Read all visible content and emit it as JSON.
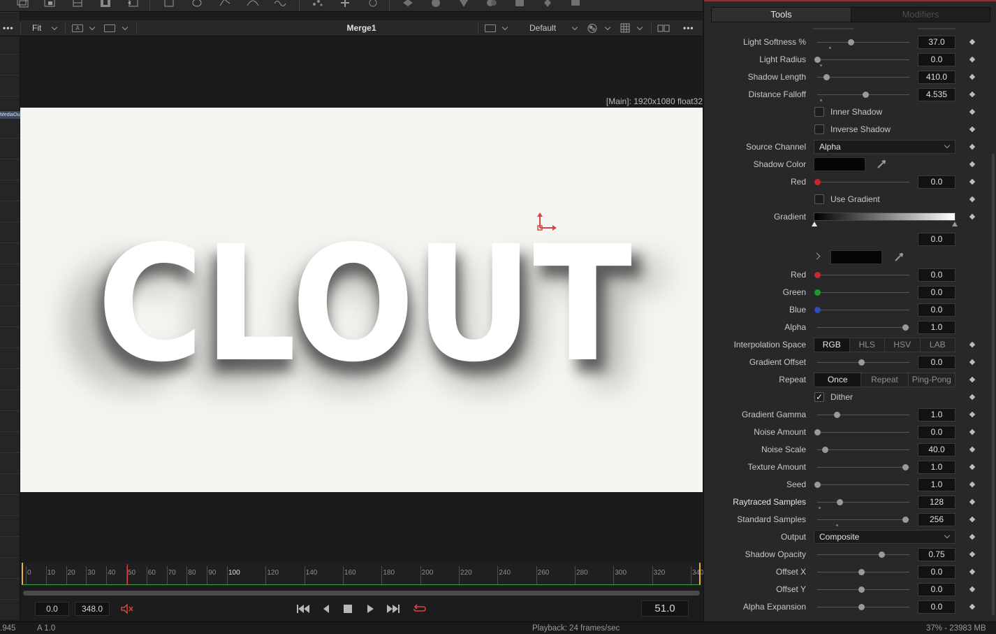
{
  "viewer": {
    "fit_label": "Fit",
    "title": "Merge1",
    "lut_label": "Default",
    "resolution_label": "[Main]: 1920x1080 float32",
    "canvas_text": "CLOUT",
    "media_out_tab": "MediaOu"
  },
  "timeline": {
    "ticks": [
      "0",
      "10",
      "20",
      "30",
      "40",
      "50",
      "60",
      "70",
      "80",
      "90",
      "100",
      "120",
      "140",
      "160",
      "180",
      "200",
      "220",
      "240",
      "260",
      "280",
      "300",
      "320",
      "340"
    ],
    "playhead_frame": 51,
    "range_max": 348
  },
  "transport": {
    "start_value": "0.0",
    "end_value": "348.0",
    "current_frame": "51.0"
  },
  "status": {
    "left_value": ".945",
    "alpha_value": "A 1.0",
    "playback": "Playback: 24 frames/sec",
    "memory": "37% - 23983 MB"
  },
  "inspector": {
    "tab_tools": "Tools",
    "tab_modifiers": "Modifiers",
    "light_softness": {
      "label": "Light Softness %",
      "value": "37.0",
      "level": 0.38
    },
    "light_radius": {
      "label": "Light Radius",
      "value": "0.0",
      "level": 0.0
    },
    "shadow_length": {
      "label": "Shadow Length",
      "value": "410.0",
      "level": 0.1
    },
    "distance_falloff": {
      "label": "Distance Falloff",
      "value": "4.535",
      "level": 0.55
    },
    "inner_shadow": {
      "label": "Inner Shadow",
      "checked": false
    },
    "inverse_shadow": {
      "label": "Inverse Shadow",
      "checked": false
    },
    "source_channel": {
      "label": "Source Channel",
      "value": "Alpha"
    },
    "shadow_color": {
      "label": "Shadow Color",
      "color": "#050505"
    },
    "red_main": {
      "label": "Red",
      "value": "0.0",
      "level": 0.0
    },
    "use_gradient": {
      "label": "Use Gradient",
      "checked": false
    },
    "gradient": {
      "label": "Gradient",
      "value": "0.0"
    },
    "gradient_red": {
      "label": "Red",
      "value": "0.0",
      "level": 0.0
    },
    "gradient_green": {
      "label": "Green",
      "value": "0.0",
      "level": 0.0
    },
    "gradient_blue": {
      "label": "Blue",
      "value": "0.0",
      "level": 0.0
    },
    "gradient_alpha": {
      "label": "Alpha",
      "value": "1.0",
      "level": 1.0
    },
    "interpolation_space": {
      "label": "Interpolation Space",
      "options": [
        "RGB",
        "HLS",
        "HSV",
        "LAB"
      ],
      "selected": "RGB"
    },
    "gradient_offset": {
      "label": "Gradient Offset",
      "value": "0.0",
      "level": 0.5
    },
    "repeat": {
      "label": "Repeat",
      "options": [
        "Once",
        "Repeat",
        "Ping-Pong"
      ],
      "selected": "Once"
    },
    "dither": {
      "label": "Dither",
      "checked": true
    },
    "gradient_gamma": {
      "label": "Gradient Gamma",
      "value": "1.0",
      "level": 0.22
    },
    "noise_amount": {
      "label": "Noise Amount",
      "value": "0.0",
      "level": 0.0
    },
    "noise_scale": {
      "label": "Noise Scale",
      "value": "40.0",
      "level": 0.09
    },
    "texture_amount": {
      "label": "Texture Amount",
      "value": "1.0",
      "level": 1.0
    },
    "seed": {
      "label": "Seed",
      "value": "1.0",
      "level": 0.0
    },
    "raytraced_samples": {
      "label": "Raytraced Samples",
      "value": "128",
      "level": 0.25
    },
    "standard_samples": {
      "label": "Standard Samples",
      "value": "256",
      "level": 1.0
    },
    "output": {
      "label": "Output",
      "value": "Composite"
    },
    "shadow_opacity": {
      "label": "Shadow Opacity",
      "value": "0.75",
      "level": 0.73
    },
    "offset_x": {
      "label": "Offset X",
      "value": "0.0",
      "level": 0.5
    },
    "offset_y": {
      "label": "Offset Y",
      "value": "0.0",
      "level": 0.5
    },
    "alpha_expansion": {
      "label": "Alpha Expansion",
      "value": "0.0",
      "level": 0.5
    }
  },
  "colors": {
    "accent_red": "#d9453e",
    "timeline_bound": "#e5b43a",
    "canvas_bg": "#f4f4f0"
  }
}
